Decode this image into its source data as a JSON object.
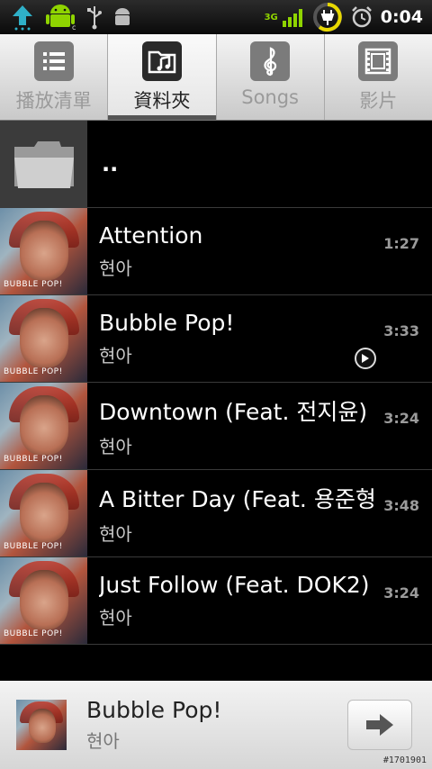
{
  "status_bar": {
    "network": "3G",
    "clock": "0:04",
    "left_icons": [
      "upload-arrow-icon",
      "android-robot-icon",
      "usb-icon",
      "android-debug-icon"
    ],
    "right_icons": [
      "signal-bars-icon",
      "charging-battery-icon",
      "alarm-clock-icon"
    ]
  },
  "tabs": [
    {
      "label": "播放清單",
      "icon": "playlist-icon",
      "active": false
    },
    {
      "label": "資料夾",
      "icon": "folder-music-icon",
      "active": true
    },
    {
      "label": "Songs",
      "icon": "treble-clef-icon",
      "active": false
    },
    {
      "label": "影片",
      "icon": "film-icon",
      "active": false
    }
  ],
  "list": {
    "parent_dir": "..",
    "songs": [
      {
        "title": "Attention",
        "artist": "현아",
        "duration": "1:27",
        "playing": false
      },
      {
        "title": "Bubble Pop!",
        "artist": "현아",
        "duration": "3:33",
        "playing": true
      },
      {
        "title": "Downtown (Feat. 전지윤)",
        "artist": "현아",
        "duration": "3:24",
        "playing": false
      },
      {
        "title": "A Bitter Day (Feat. 용준형 &",
        "artist": "현아",
        "duration": "3:48",
        "playing": false
      },
      {
        "title": "Just Follow (Feat. DOK2)",
        "artist": "현아",
        "duration": "3:24",
        "playing": false
      }
    ],
    "album_caption": "BUBBLE POP!"
  },
  "now_playing": {
    "title": "Bubble Pop!",
    "artist": "현아",
    "next_icon": "arrow-right-icon"
  },
  "watermark": "#1701901",
  "colors": {
    "accent_green": "#8fd400",
    "charge_yellow": "#e8d800"
  }
}
